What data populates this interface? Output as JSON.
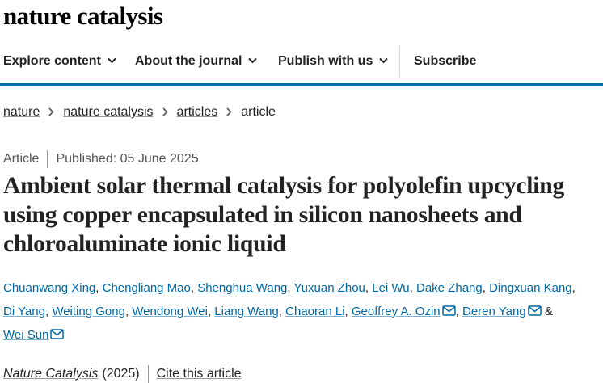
{
  "header": {
    "logo_text": "nature catalysis"
  },
  "nav": {
    "items": [
      "Explore content",
      "About the journal",
      "Publish with us"
    ],
    "subscribe": "Subscribe"
  },
  "breadcrumb": [
    "nature",
    "nature catalysis",
    "articles",
    "article"
  ],
  "article": {
    "type": "Article",
    "published": "Published: 05 June 2025",
    "title": "Ambient solar thermal catalysis for polyolefin upcycling using copper encapsulated in silicon nanosheets and chloroaluminate ionic liquid",
    "authors": [
      "Chuanwang Xing",
      "Chengliang Mao",
      "Shenghua Wang",
      "Yuxuan Zhou",
      "Lei Wu",
      "Dake Zhang",
      "Dingxuan Kang",
      "Di Yang",
      "Weiting Gong",
      "Wendong Wei",
      "Liang Wang",
      "Chaoran Li",
      "Geoffrey A. Ozin",
      "Deren Yang",
      "Wei Sun"
    ],
    "author_and": "&",
    "journal": "Nature Catalysis",
    "year": "(2025)",
    "cite_label": "Cite this article"
  },
  "colors": {
    "accent": "#0070a8",
    "link": "#0067a5"
  }
}
